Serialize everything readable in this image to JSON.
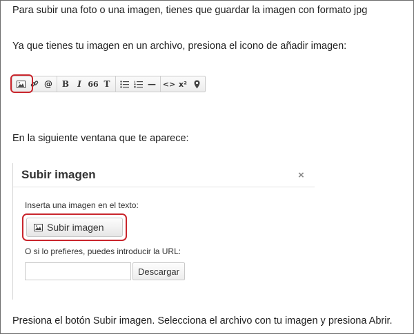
{
  "paragraphs": {
    "p1": "Para subir una foto o una imagen, tienes que guardar la imagen con formato jpg",
    "p2": "Ya que tienes tu imagen en un archivo, presiona el icono de añadir imagen:",
    "p3": "En la siguiente ventana que te aparece:",
    "p4": "Presiona el botón Subir imagen. Selecciona el archivo con tu imagen y presiona Abrir."
  },
  "toolbar": {
    "buttons": [
      {
        "icon": "image-icon"
      },
      {
        "icon": "link-icon"
      },
      {
        "icon": "at-icon",
        "label": "@"
      },
      {
        "icon": "bold-icon",
        "label": "B"
      },
      {
        "icon": "italic-icon",
        "label": "I"
      },
      {
        "icon": "quote-icon",
        "label": "66"
      },
      {
        "icon": "text-icon",
        "label": "T"
      },
      {
        "icon": "bullet-list-icon"
      },
      {
        "icon": "numbered-list-icon"
      },
      {
        "icon": "horizontal-rule-icon",
        "label": "—"
      },
      {
        "icon": "code-icon",
        "label": "<>"
      },
      {
        "icon": "superscript-icon",
        "label": "x²"
      },
      {
        "icon": "location-pin-icon"
      }
    ]
  },
  "dialog": {
    "title": "Subir imagen",
    "close_label": "×",
    "insert_text": "Inserta una imagen en el texto:",
    "upload_label": "Subir imagen",
    "url_text": "O si lo prefieres, puedes introducir la URL:",
    "url_value": "",
    "download_label": "Descargar"
  },
  "colors": {
    "highlight": "#c9252c"
  }
}
